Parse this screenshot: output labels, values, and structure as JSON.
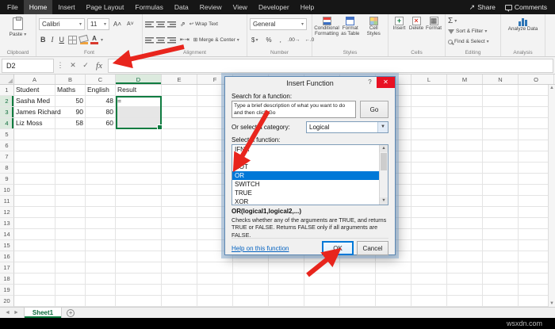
{
  "menu": {
    "tabs": [
      "File",
      "Home",
      "Insert",
      "Page Layout",
      "Formulas",
      "Data",
      "Review",
      "View",
      "Developer",
      "Help"
    ],
    "active_tab": "Home",
    "share_label": "Share",
    "comments_label": "Comments"
  },
  "ribbon": {
    "groups": [
      "Clipboard",
      "Font",
      "Alignment",
      "Number",
      "Styles",
      "Cells",
      "Editing",
      "Analysis"
    ],
    "paste_label": "Paste",
    "font_name": "Calibri",
    "font_size": "11",
    "bold_label": "B",
    "italic_label": "I",
    "underline_label": "U",
    "wrap_text_label": "Wrap Text",
    "merge_center_label": "Merge & Center",
    "number_format": "General",
    "currency_label": "$",
    "percent_label": "%",
    "comma_label": ",",
    "conditional_formatting_label": "Conditional Formatting",
    "format_as_table_label": "Format as Table",
    "cell_styles_label": "Cell Styles",
    "insert_label": "Insert",
    "delete_label": "Delete",
    "format_label": "Format",
    "autosum_label": "Σ",
    "sort_filter_label": "Sort & Filter",
    "find_select_label": "Find & Select",
    "analyze_data_label": "Analyze Data"
  },
  "formula_bar": {
    "name_box": "D2",
    "cancel_glyph": "✕",
    "enter_glyph": "✓",
    "fx_label": "fx",
    "formula_value": ""
  },
  "grid": {
    "columns": [
      "A",
      "B",
      "C",
      "D",
      "E",
      "F",
      "G",
      "H",
      "I",
      "J",
      "K",
      "L",
      "M",
      "N",
      "O"
    ],
    "row_count": 20,
    "cells": {
      "A1": "Student",
      "B1": "Maths",
      "C1": "English",
      "D1": "Result",
      "A2": "Sasha Med",
      "B2": "50",
      "C2": "48",
      "D2": "=",
      "A3": "James Richard",
      "B3": "90",
      "C3": "80",
      "A4": "Liz Moss",
      "B4": "58",
      "C4": "60"
    },
    "numeric_cells": [
      "B2",
      "C2",
      "B3",
      "C3",
      "B4",
      "C4"
    ],
    "active_cell": "D2",
    "selection": {
      "col": "D",
      "row_start": 2,
      "row_end": 4
    }
  },
  "dialog": {
    "title": "Insert Function",
    "help_button": "?",
    "close_button": "✕",
    "search_label": "Search for a function:",
    "search_placeholder": "Type a brief description of what you want to do and then click Go",
    "go_label": "Go",
    "category_label": "Or select a category:",
    "category_value": "Logical",
    "select_label": "Select a function:",
    "functions": [
      "IFNA",
      "IFS",
      "NOT",
      "OR",
      "SWITCH",
      "TRUE",
      "XOR"
    ],
    "selected_function": "OR",
    "signature": "OR(logical1,logical2,...)",
    "description": "Checks whether any of the arguments are TRUE, and returns TRUE or FALSE. Returns FALSE only if all arguments are FALSE.",
    "help_link": "Help on this function",
    "ok_label": "OK",
    "cancel_label": "Cancel"
  },
  "sheet_bar": {
    "tab": "Sheet1"
  },
  "watermark": "wsxdn.com",
  "colors": {
    "accent_green": "#107c41",
    "selection_blue": "#0078d7",
    "arrow_red": "#e8251d",
    "close_red": "#e81123"
  }
}
